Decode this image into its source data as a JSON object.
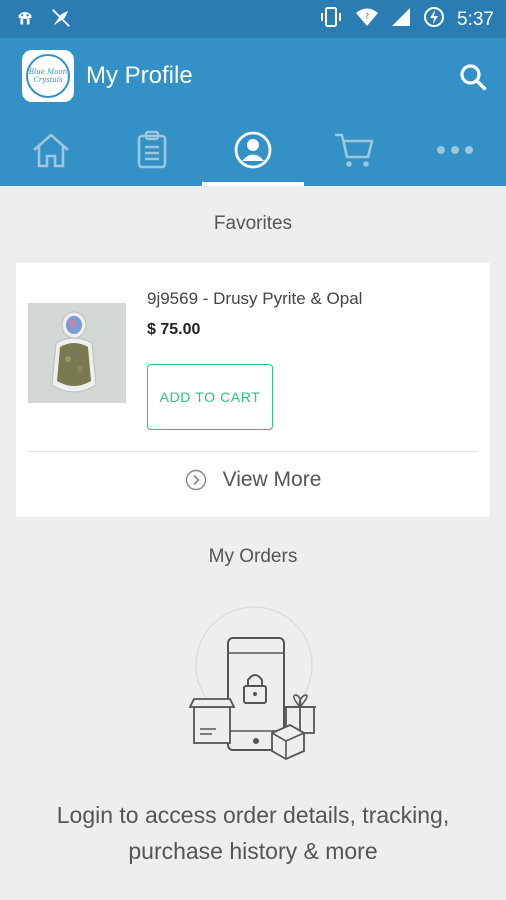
{
  "status_bar": {
    "time": "5:37",
    "icons": [
      "android-debug-icon",
      "notification-icon",
      "vibrate-icon",
      "wifi-icon",
      "signal-icon",
      "battery-charging-icon"
    ]
  },
  "app_bar": {
    "title": "My Profile",
    "logo_text": "Blue Moon Crystals",
    "search_icon": "search-icon"
  },
  "tabs": [
    {
      "name": "home",
      "icon": "home-icon",
      "active": false
    },
    {
      "name": "catalog",
      "icon": "clipboard-icon",
      "active": false
    },
    {
      "name": "profile",
      "icon": "profile-icon",
      "active": true
    },
    {
      "name": "cart",
      "icon": "cart-icon",
      "active": false
    },
    {
      "name": "more",
      "icon": "more-icon",
      "active": false
    }
  ],
  "favorites": {
    "title": "Favorites",
    "product": {
      "name": "9j9569 - Drusy Pyrite & Opal",
      "price": "$ 75.00",
      "add_to_cart_label": "ADD TO CART"
    },
    "view_more_label": "View More"
  },
  "orders": {
    "title": "My Orders",
    "login_message": "Login to access order details, tracking, purchase history & more"
  },
  "colors": {
    "primary": "#3391c6",
    "status_bar": "#2a7db3",
    "accent_green": "#2fc27b",
    "background": "#eeeeee"
  }
}
